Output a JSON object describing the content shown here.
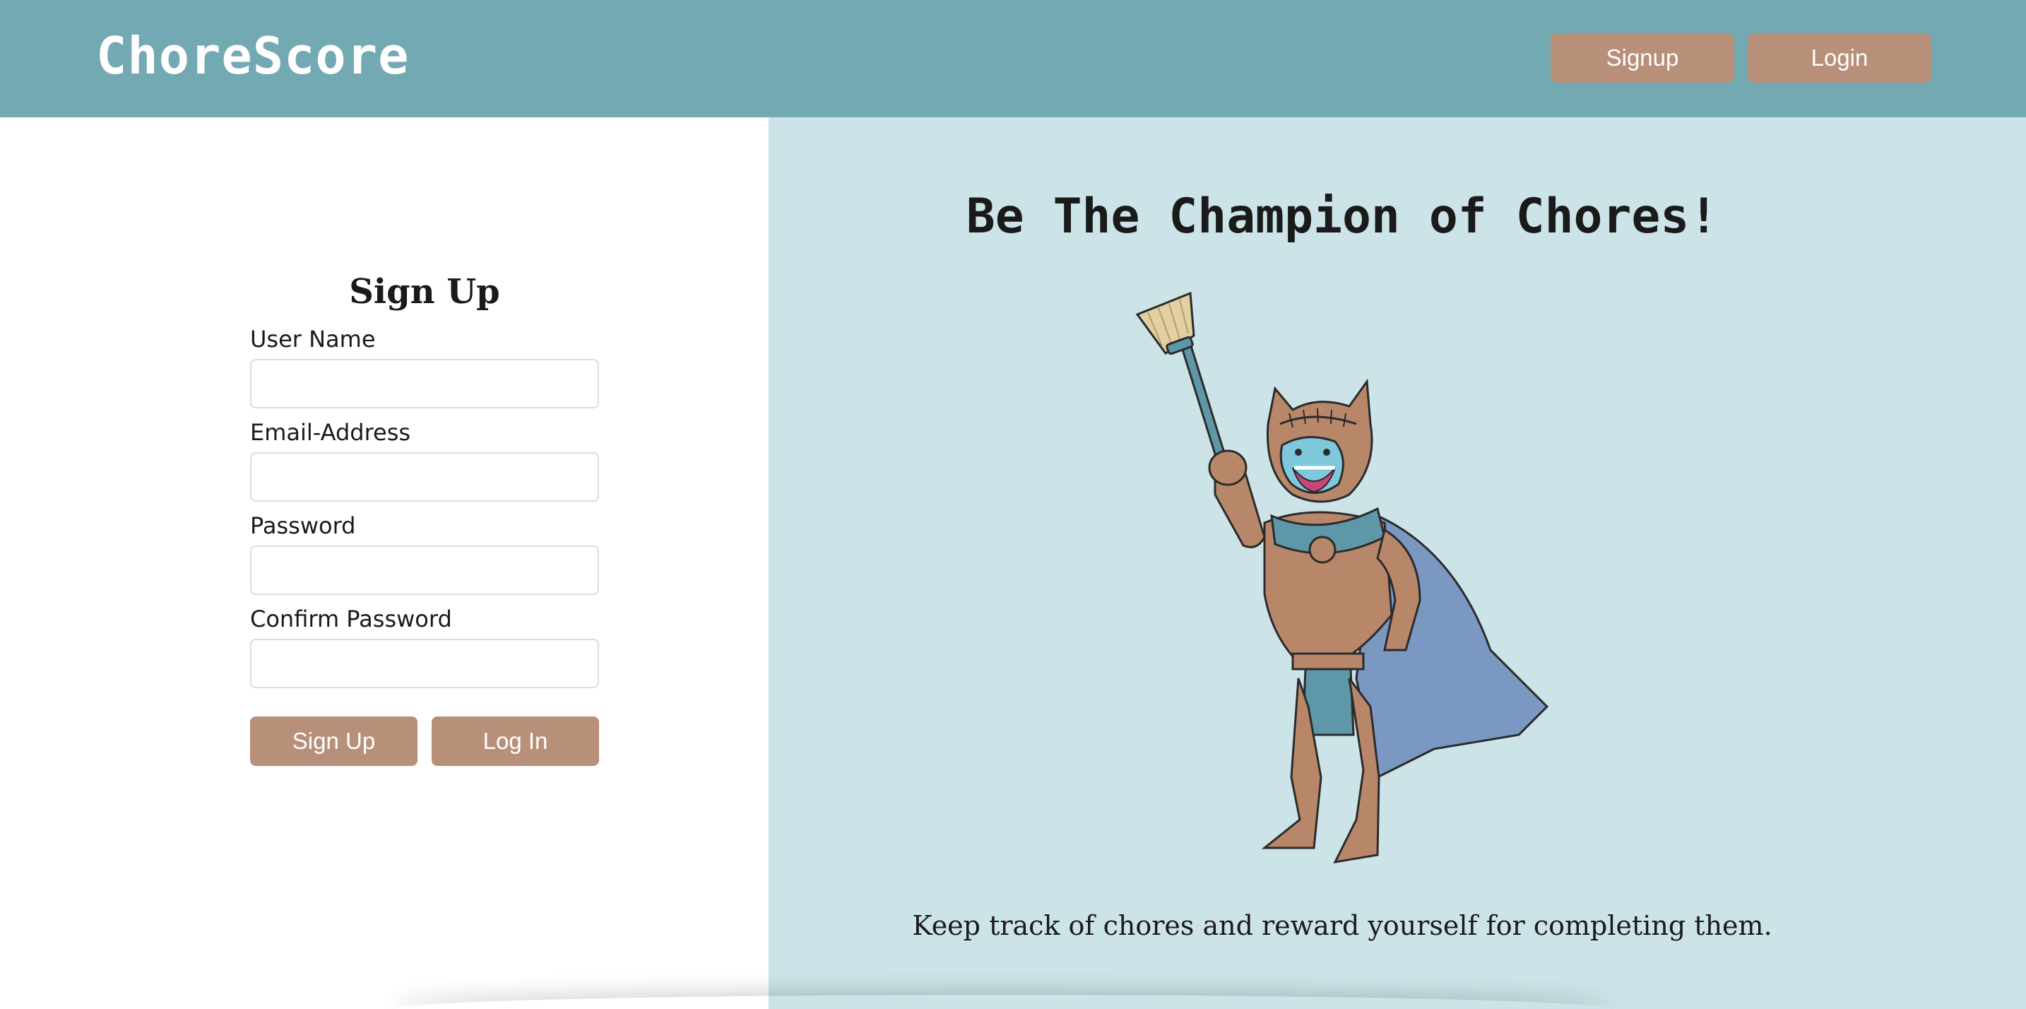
{
  "navbar": {
    "brand": "ChoreScore",
    "signup_label": "Signup",
    "login_label": "Login",
    "background_color": "#73a9b3",
    "button_color": "#b89079"
  },
  "signup_form": {
    "title": "Sign Up",
    "fields": [
      {
        "label": "User Name",
        "value": ""
      },
      {
        "label": "Email-Address",
        "value": ""
      },
      {
        "label": "Password",
        "value": ""
      },
      {
        "label": "Confirm Password",
        "value": ""
      }
    ],
    "signup_button": "Sign Up",
    "login_button": "Log In"
  },
  "hero": {
    "title": "Be The Champion of Chores!",
    "image_icon": "armored-cat-knight-with-broom-illustration",
    "tagline": "Keep track of chores and reward yourself for completing them.",
    "background_color": "#cce4e8"
  }
}
